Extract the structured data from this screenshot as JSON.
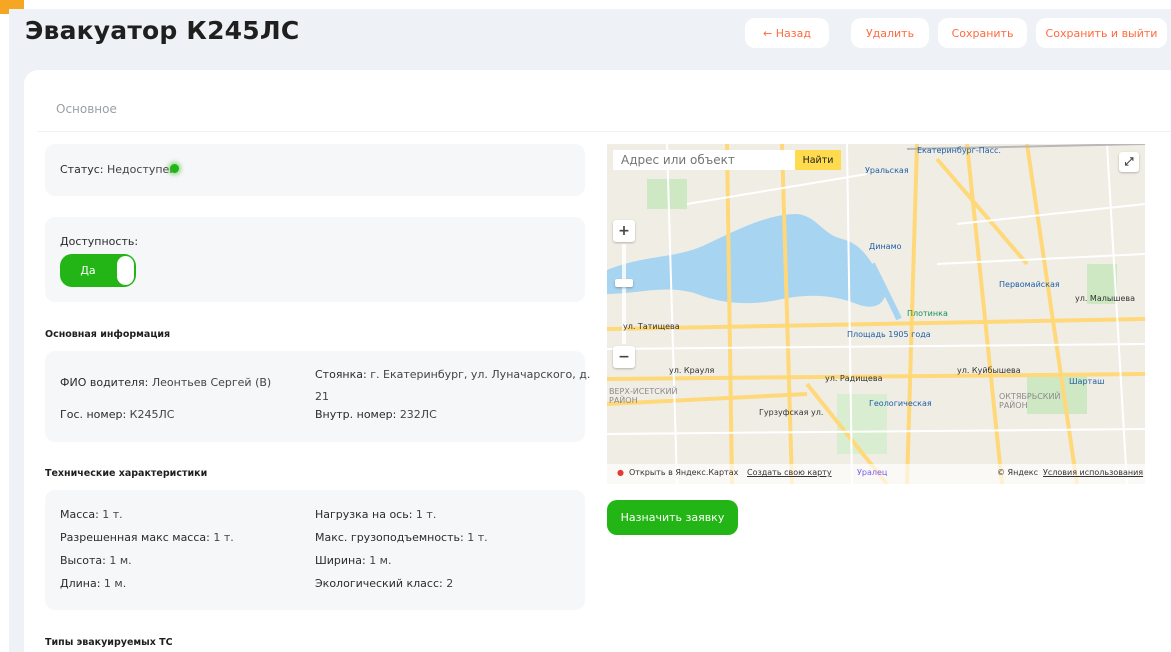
{
  "header": {
    "title": "Эвакуатор К245ЛС",
    "back_label": "← Назад",
    "delete_label": "Удалить",
    "save_label": "Сохранить",
    "save_exit_label": "Сохранить и выйти"
  },
  "tabs": {
    "main": "Основное"
  },
  "status": {
    "label": "Статус:",
    "value": "Недоступен"
  },
  "availability": {
    "label": "Доступность:",
    "toggle_label": "Да"
  },
  "basic_info": {
    "title": "Основная информация",
    "driver_label": "ФИО водителя:",
    "driver_value": "Леонтьев Сергей (В)",
    "plate_label": "Гос. номер:",
    "plate_value": "К245ЛС",
    "parking_label": "Стоянка:",
    "parking_value_line1": "г. Екатеринбург, ул. Луначарского, д.",
    "parking_value_line2": "21",
    "internal_label": "Внутр. номер:",
    "internal_value": "232ЛС"
  },
  "tech": {
    "title": "Технические характеристики",
    "mass_label": "Масса:",
    "mass_value": "1 т.",
    "allowed_mass_label": "Разрешенная макс масса:",
    "allowed_mass_value": "1 т.",
    "height_label": "Высота:",
    "height_value": "1 м.",
    "length_label": "Длина:",
    "length_value": "1 м.",
    "axle_label": "Нагрузка на ось:",
    "axle_value": "1 т.",
    "capacity_label": "Макс. грузоподъемность:",
    "capacity_value": "1 т.",
    "width_label": "Ширина:",
    "width_value": "1 м.",
    "eco_label": "Экологический класс:",
    "eco_value": "2"
  },
  "types_title": "Типы эвакуируемых ТС",
  "map": {
    "search_placeholder": "Адрес или объект",
    "find_label": "Найти",
    "zoom_in": "+",
    "zoom_out": "−",
    "labels": {
      "station": "Екатеринбург-Пасс.",
      "uralskaya": "Уральская",
      "dinamo": "Динамо",
      "pervomayskaya": "Первомайская",
      "plotinka": "Плотинка",
      "ploshchad": "Площадь 1905 года",
      "geologicheskaya": "Геологическая",
      "verh_isetsky": "ВЕРХ-ИСЕТСКИЙ РАЙОН",
      "oktyabrsky": "ОКТЯБРЬСКИЙ РАЙОН",
      "shartash": "Шарташ",
      "tatishcheva": "ул. Татищева",
      "krauly": "ул. Крауля",
      "radishcheva": "ул. Радищева",
      "kuybysheva": "ул. Куйбышева",
      "gurzufskaya": "Гурзуфская ул.",
      "malysheva": "ул. Малышева",
      "uralets": "Уралец"
    },
    "open_in": "Открыть в Яндекс.Картах",
    "create_map": "Создать свою карту",
    "copyright": "© Яндекс",
    "terms": "Условия использования"
  },
  "assign_label": "Назначить заявку",
  "colors": {
    "accent_green": "#22b515",
    "accent_orange": "#ff6a3d",
    "page_bg": "#eef1f5",
    "panel_bg": "#f6f7f8"
  }
}
